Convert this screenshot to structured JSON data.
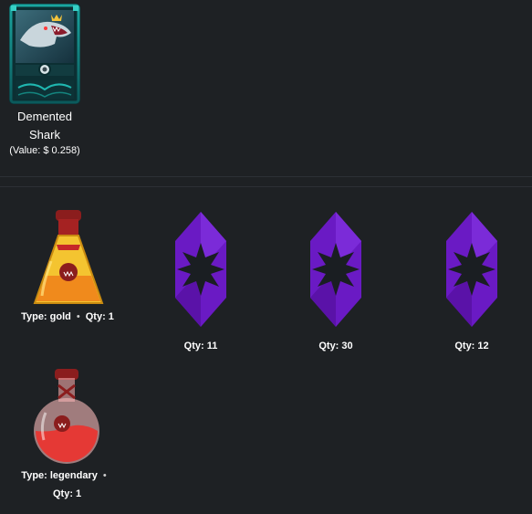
{
  "card": {
    "name": "Demented Shark",
    "value_text": "(Value: $ 0.258)"
  },
  "rewards": [
    {
      "icon": "gold-potion-icon",
      "type_label": "Type: gold",
      "separator": "•",
      "qty_label": "Qty: 1"
    },
    {
      "icon": "purple-shard-icon",
      "qty_label": "Qty: 11"
    },
    {
      "icon": "purple-shard-icon",
      "qty_label": "Qty: 30"
    },
    {
      "icon": "purple-shard-icon",
      "qty_label": "Qty: 12"
    },
    {
      "icon": "legendary-potion-icon",
      "type_label": "Type: legendary",
      "separator": "•",
      "qty_label": "Qty: 1"
    }
  ],
  "colors": {
    "background": "#1e2124",
    "shard": "#6a1ac4",
    "gold_potion": "#f0a020",
    "legendary_potion": "#e53935"
  }
}
